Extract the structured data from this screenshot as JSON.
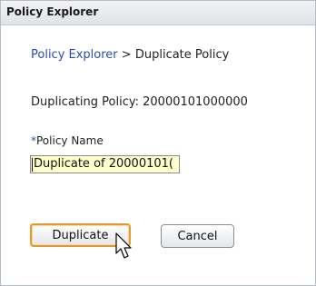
{
  "window": {
    "title": "Policy Explorer"
  },
  "breadcrumb": {
    "link": "Policy Explorer",
    "separator": ">",
    "current": "Duplicate Policy"
  },
  "duplicating": {
    "label": "Duplicating Policy:",
    "value": "20000101000000"
  },
  "form": {
    "required_marker": "*",
    "policy_name_label": "Policy Name",
    "policy_name_value": "Duplicate of 20000101("
  },
  "buttons": {
    "duplicate": "Duplicate",
    "cancel": "Cancel"
  },
  "icons": {
    "cursor": "arrow-pointer-icon"
  },
  "colors": {
    "link": "#2a4fa8",
    "input_background": "#ffffcc",
    "focus_border": "#e09a2e",
    "titlebar": "#dfe2e7"
  }
}
